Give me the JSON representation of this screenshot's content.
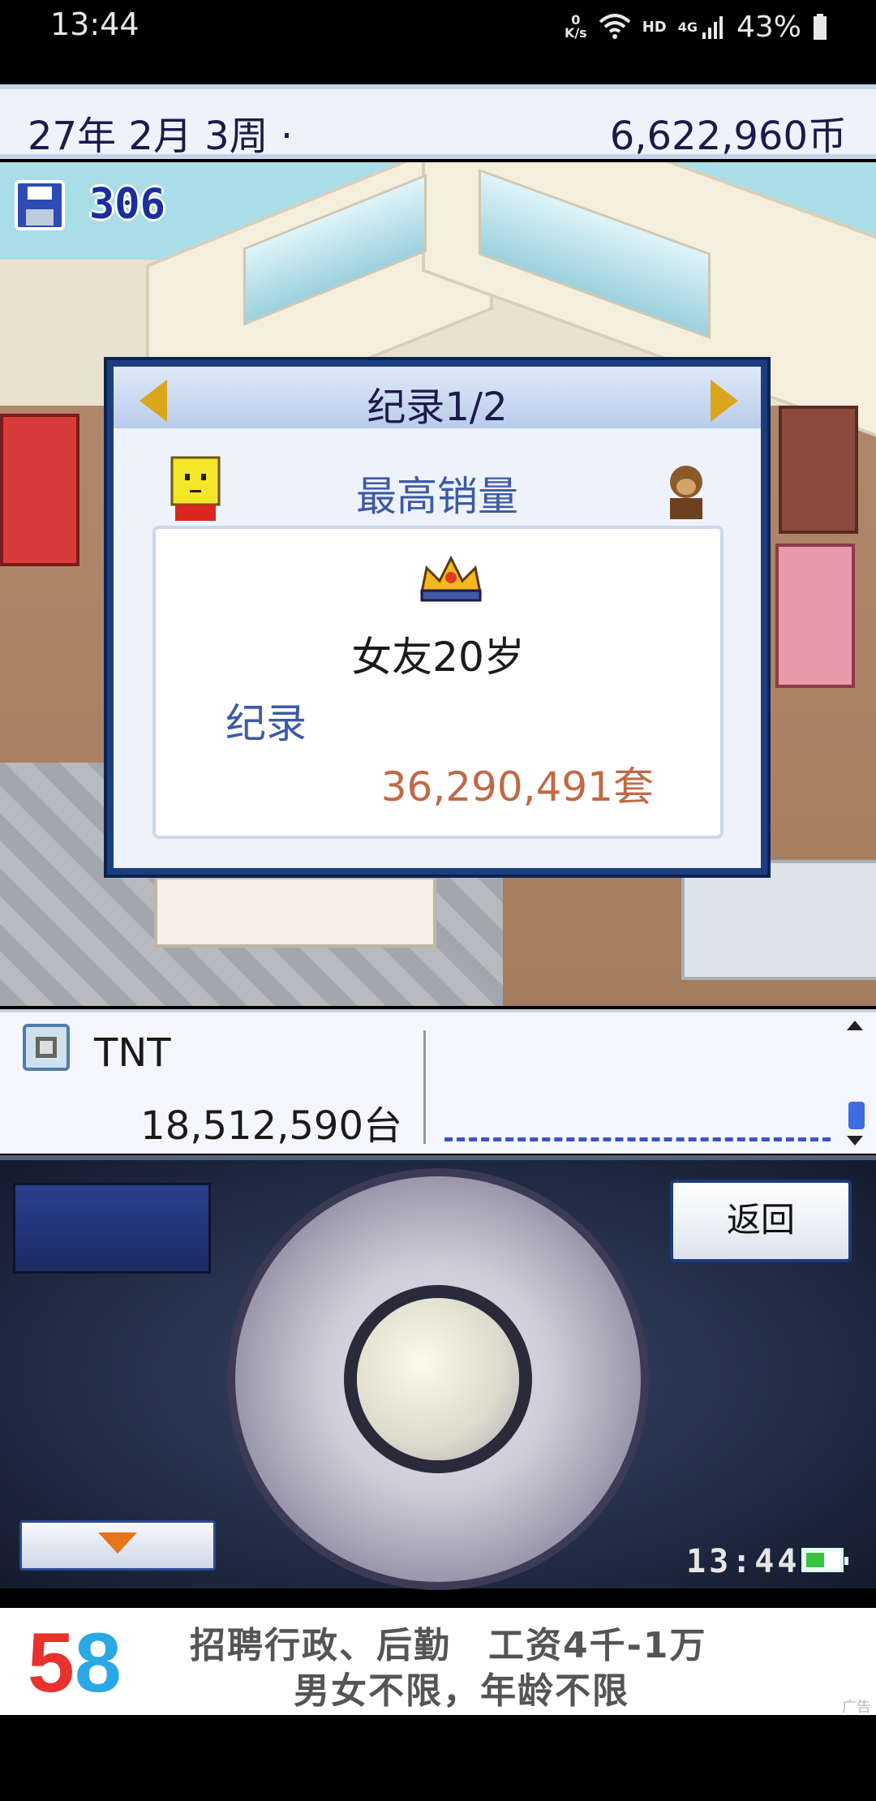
{
  "status_bar": {
    "time": "13:44",
    "net_speed_top": "0",
    "net_speed_bottom": "K/s",
    "hd": "HD",
    "network": "4G",
    "battery_percent": "43%"
  },
  "header": {
    "date": "27年 2月 3周 ·",
    "money": "6,622,960币"
  },
  "save": {
    "count": "306"
  },
  "dialog": {
    "title": "纪录1/2",
    "subtitle": "最高销量",
    "game_name": "女友20岁",
    "record_label": "纪录",
    "record_value": "36,290,491套"
  },
  "info_panel": {
    "console_name": "TNT",
    "console_sales": "18,512,590台"
  },
  "controller": {
    "back_label": "返回",
    "clock": "13:44"
  },
  "ad": {
    "logo_digit_1": "5",
    "logo_digit_2": "8",
    "line1": "招聘行政、后勤　工资4千-1万",
    "line2": "男女不限，年龄不限",
    "tag": "广告"
  },
  "colors": {
    "dialog_frame": "#1d3e7e",
    "record_value": "#c06a45",
    "accent_blue": "#3e5aa5",
    "arrow_gold": "#d9a61c"
  },
  "icons": [
    "wifi-icon",
    "signal-icon",
    "battery-icon",
    "save-icon",
    "crown-icon",
    "console-icon",
    "arrow-left-icon",
    "arrow-right-icon",
    "down-arrow-icon"
  ]
}
